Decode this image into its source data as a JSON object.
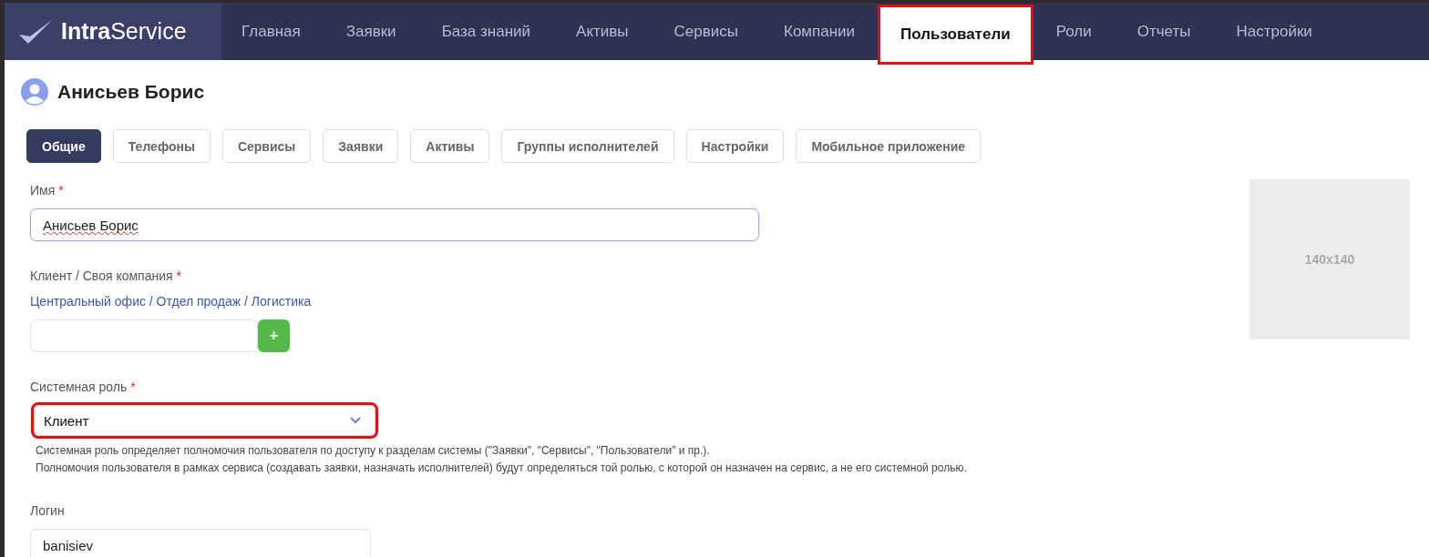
{
  "logo": {
    "strong": "Intra",
    "rest": "Service"
  },
  "nav": [
    {
      "label": "Главная",
      "selected": false,
      "highlighted": false
    },
    {
      "label": "Заявки",
      "selected": false,
      "highlighted": false
    },
    {
      "label": "База знаний",
      "selected": false,
      "highlighted": false
    },
    {
      "label": "Активы",
      "selected": false,
      "highlighted": false
    },
    {
      "label": "Сервисы",
      "selected": false,
      "highlighted": false
    },
    {
      "label": "Компании",
      "selected": false,
      "highlighted": false
    },
    {
      "label": "Пользователи",
      "selected": true,
      "highlighted": true
    },
    {
      "label": "Роли",
      "selected": false,
      "highlighted": false
    },
    {
      "label": "Отчеты",
      "selected": false,
      "highlighted": false
    },
    {
      "label": "Настройки",
      "selected": false,
      "highlighted": false
    }
  ],
  "title": "Анисьев Борис",
  "tabs": [
    {
      "label": "Общие",
      "selected": true
    },
    {
      "label": "Телефоны",
      "selected": false
    },
    {
      "label": "Сервисы",
      "selected": false
    },
    {
      "label": "Заявки",
      "selected": false
    },
    {
      "label": "Активы",
      "selected": false
    },
    {
      "label": "Группы исполнителей",
      "selected": false
    },
    {
      "label": "Настройки",
      "selected": false
    },
    {
      "label": "Мобильное приложение",
      "selected": false
    }
  ],
  "fields": [
    {
      "kind": "text",
      "label": "Имя",
      "required_mark": "*",
      "value": "Анисьев Борис",
      "focused": true
    },
    {
      "kind": "company",
      "label": "Клиент / Своя компания",
      "required_mark": "*",
      "link": "Центральный офис / Отдел продаж / Логистика",
      "add_button": "+"
    },
    {
      "kind": "select",
      "label": "Системная роль",
      "required_mark": "*",
      "value": "Клиент",
      "highlighted": true,
      "help": [
        "Системная роль определяет полномочия пользователя по доступу к разделам системы (\"Заявки\", \"Сервисы\", \"Пользователи\" и пр.).",
        "Полномочия пользователя в рамках сервиса (создавать заявки, назначать исполнителей) будут определяться той ролью, с которой он назначен на сервис, а не его системной ролью."
      ]
    },
    {
      "kind": "text",
      "label": "Логин",
      "value": "banisiev",
      "focused": false
    }
  ],
  "photo": {
    "placeholder": "140x140"
  }
}
